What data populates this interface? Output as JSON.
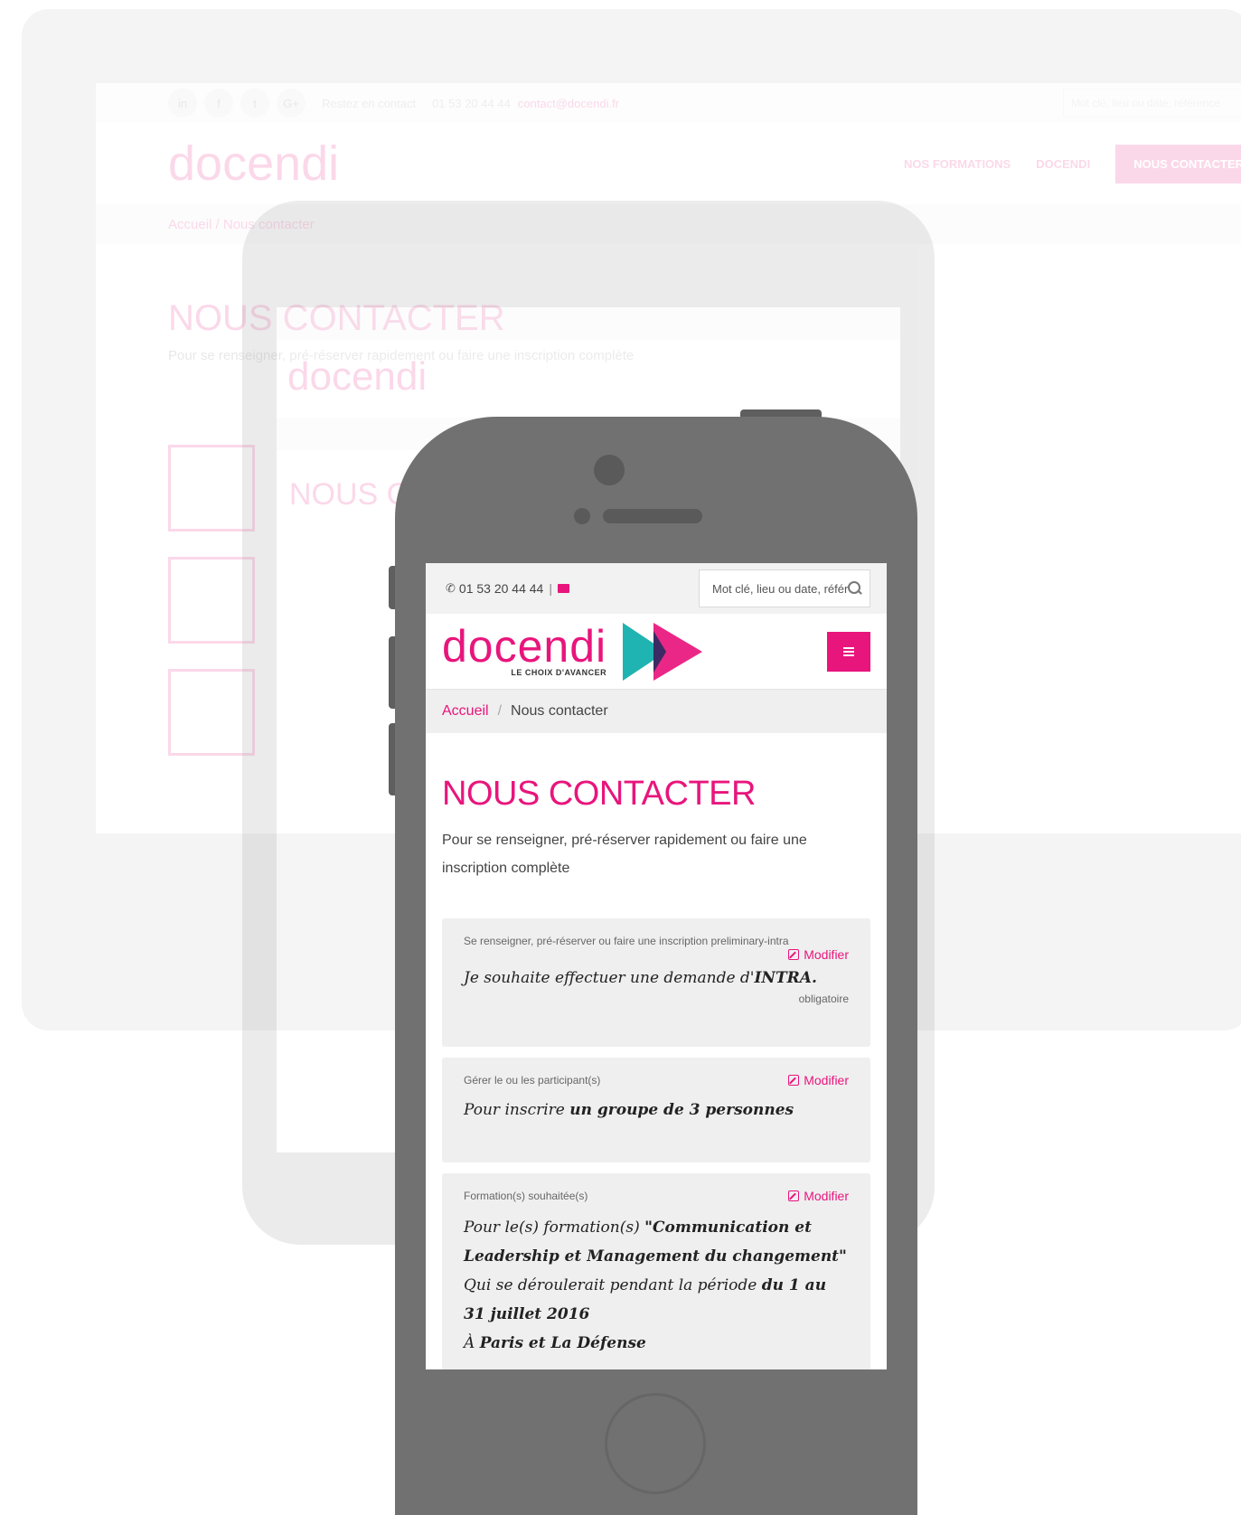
{
  "colors": {
    "accent": "#e8157c",
    "teal": "#1fb3b1",
    "phone_body": "#717171"
  },
  "background_desktop": {
    "topbar": {
      "social": [
        "in",
        "f",
        "t",
        "G+"
      ],
      "contact_text": "Restez en contact",
      "phone": "01 53 20 44 44",
      "email": "contact@docendi.fr",
      "search_placeholder": "Mot clé, lieu ou date, référence"
    },
    "logo": "docendi",
    "nav": [
      "NOS FORMATIONS",
      "DOCENDI",
      "NOUS CONTACTER"
    ],
    "breadcrumb": "Accueil  /  Nous contacter",
    "title": "NOUS CONTACTER",
    "subtitle": "Pour se renseigner, pré-réserver rapidement ou faire une inscription complète"
  },
  "background_tablet": {
    "logo": "docendi",
    "title": "NOUS CONTACTER"
  },
  "phone": {
    "topbar": {
      "phone_number": "01 53 20 44 44",
      "separator": "|",
      "search_placeholder": "Mot clé, lieu ou date, référence"
    },
    "logo": {
      "name": "docendi",
      "tagline": "LE CHOIX D'AVANCER"
    },
    "breadcrumb": {
      "home": "Accueil",
      "separator": "/",
      "current": "Nous contacter"
    },
    "page": {
      "title": "NOUS CONTACTER",
      "subtitle": "Pour se renseigner, pré-réserver rapidement ou faire une inscription complète"
    },
    "cards": [
      {
        "heading": "Se renseigner, pré-réserver ou faire une inscription preliminary-intra",
        "modify": "Modifier",
        "body_prefix": "Je souhaite effectuer une demande d'",
        "body_bold": "INTRA.",
        "required": "obligatoire"
      },
      {
        "heading": "Gérer le ou les participant(s)",
        "modify": "Modifier",
        "body_prefix": "Pour inscrire ",
        "body_bold": "un groupe de 3 personnes"
      },
      {
        "heading": "Formation(s) souhaitée(s)",
        "modify": "Modifier",
        "line1_prefix": "Pour le(s) formation(s) ",
        "line1_bold": "\"Communication et Leadership et Management du changement\"",
        "line2_prefix": "Qui se déroulerait pendant la période ",
        "line2_bold": "du 1 au 31 juillet 2016",
        "line3_prefix": "À ",
        "line3_bold": "Paris et La Défense"
      }
    ]
  }
}
